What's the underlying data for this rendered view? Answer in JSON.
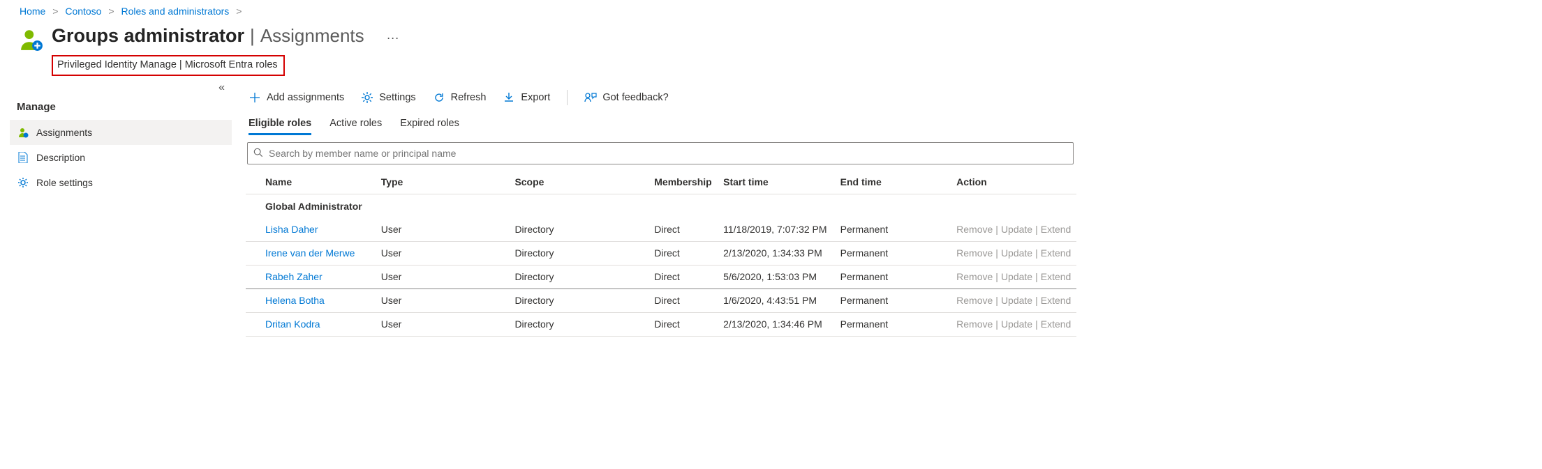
{
  "breadcrumb": [
    {
      "label": "Home"
    },
    {
      "label": "Contoso"
    },
    {
      "label": "Roles and administrators"
    }
  ],
  "title": {
    "main": "Groups administrator",
    "sep": "|",
    "sub": "Assignments",
    "more": "···"
  },
  "subtitle": "Privileged Identity Manage | Microsoft Entra roles",
  "collapse_glyph": "«",
  "sidebar": {
    "heading": "Manage",
    "items": [
      {
        "label": "Assignments",
        "active": true
      },
      {
        "label": "Description",
        "active": false
      },
      {
        "label": "Role settings",
        "active": false
      }
    ]
  },
  "toolbar": {
    "add": "Add assignments",
    "settings": "Settings",
    "refresh": "Refresh",
    "export": "Export",
    "feedback": "Got feedback?"
  },
  "tabs": {
    "eligible": "Eligible roles",
    "active": "Active roles",
    "expired": "Expired roles"
  },
  "search": {
    "placeholder": "Search by member name or principal name"
  },
  "columns": {
    "name": "Name",
    "type": "Type",
    "scope": "Scope",
    "membership": "Membership",
    "start": "Start time",
    "end": "End time",
    "action": "Action"
  },
  "group_label": "Global Administrator",
  "row_actions": {
    "remove": "Remove",
    "update": "Update",
    "extend": "Extend"
  },
  "rows": [
    {
      "name": "Lisha Daher",
      "type": "User",
      "scope": "Directory",
      "membership": "Direct",
      "start": "11/18/2019, 7:07:32 PM",
      "end": "Permanent",
      "sel": false
    },
    {
      "name": "Irene van der Merwe",
      "type": "User",
      "scope": "Directory",
      "membership": "Direct",
      "start": "2/13/2020, 1:34:33 PM",
      "end": "Permanent",
      "sel": false
    },
    {
      "name": "Rabeh Zaher",
      "type": "User",
      "scope": "Directory",
      "membership": "Direct",
      "start": "5/6/2020, 1:53:03 PM",
      "end": "Permanent",
      "sel": true
    },
    {
      "name": "Helena Botha",
      "type": "User",
      "scope": "Directory",
      "membership": "Direct",
      "start": "1/6/2020, 4:43:51 PM",
      "end": "Permanent",
      "sel": false
    },
    {
      "name": "Dritan Kodra",
      "type": "User",
      "scope": "Directory",
      "membership": "Direct",
      "start": "2/13/2020, 1:34:46 PM",
      "end": "Permanent",
      "sel": false
    }
  ]
}
